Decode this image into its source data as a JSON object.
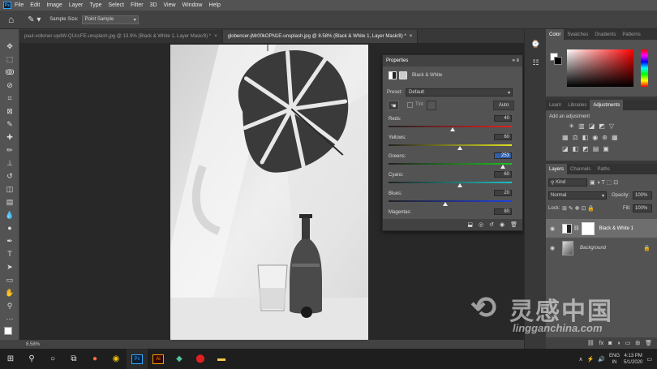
{
  "menubar": {
    "app_icon": "Ps",
    "items": [
      "File",
      "Edit",
      "Image",
      "Layer",
      "Type",
      "Select",
      "Filter",
      "3D",
      "View",
      "Window",
      "Help"
    ]
  },
  "options": {
    "sample_size_label": "Sample Size:",
    "sample_size_value": "Point Sample"
  },
  "document_tabs": [
    {
      "label": "paul-volkmer-updW-QUccFE-unsplash.jpg @ 13.9% (Black & White 1, Layer Mask/8) *",
      "close": "×"
    },
    {
      "label": "globencer-jMr00kOPN1E-unsplash.jpg @ 8.58% (Black & White 1, Layer Mask/8) *",
      "close": "×"
    }
  ],
  "status": {
    "zoom": "8.58%"
  },
  "properties": {
    "title": "Properties",
    "adjustment_name": "Black & White",
    "preset_label": "Preset:",
    "preset_value": "Default",
    "tint_label": "Tint",
    "auto_label": "Auto",
    "sliders": [
      {
        "name": "Reds:",
        "value": "40",
        "position": 0.52
      },
      {
        "name": "Yellows:",
        "value": "60",
        "position": 0.58
      },
      {
        "name": "Greens:",
        "value": "253",
        "position": 0.93
      },
      {
        "name": "Cyans:",
        "value": "60",
        "position": 0.58
      },
      {
        "name": "Blues:",
        "value": "20",
        "position": 0.46
      },
      {
        "name": "Magentas:",
        "value": "80",
        "position": 0.64
      }
    ]
  },
  "color_panel": {
    "tabs": [
      "Color",
      "Swatches",
      "Gradients",
      "Patterns"
    ],
    "hue_color": "#ff0000"
  },
  "adjustments_panel": {
    "tabs": [
      "Learn",
      "Libraries",
      "Adjustments"
    ],
    "add_label": "Add an adjustment"
  },
  "layers_panel": {
    "tabs": [
      "Layers",
      "Channels",
      "Paths"
    ],
    "kind_label": "Kind",
    "blend_mode": "Normal",
    "opacity_label": "Opacity:",
    "opacity_value": "100%",
    "lock_label": "Lock:",
    "fill_label": "Fill:",
    "fill_value": "100%",
    "layers": [
      {
        "name": "Black & White 1"
      },
      {
        "name": "Background"
      }
    ]
  },
  "taskbar": {
    "lang_top": "ENG",
    "lang_bottom": "IN",
    "time": "4:13 PM",
    "date": "5/1/2020"
  },
  "watermark": {
    "cn_text": "灵感中国",
    "url": "lingganchina.com"
  }
}
